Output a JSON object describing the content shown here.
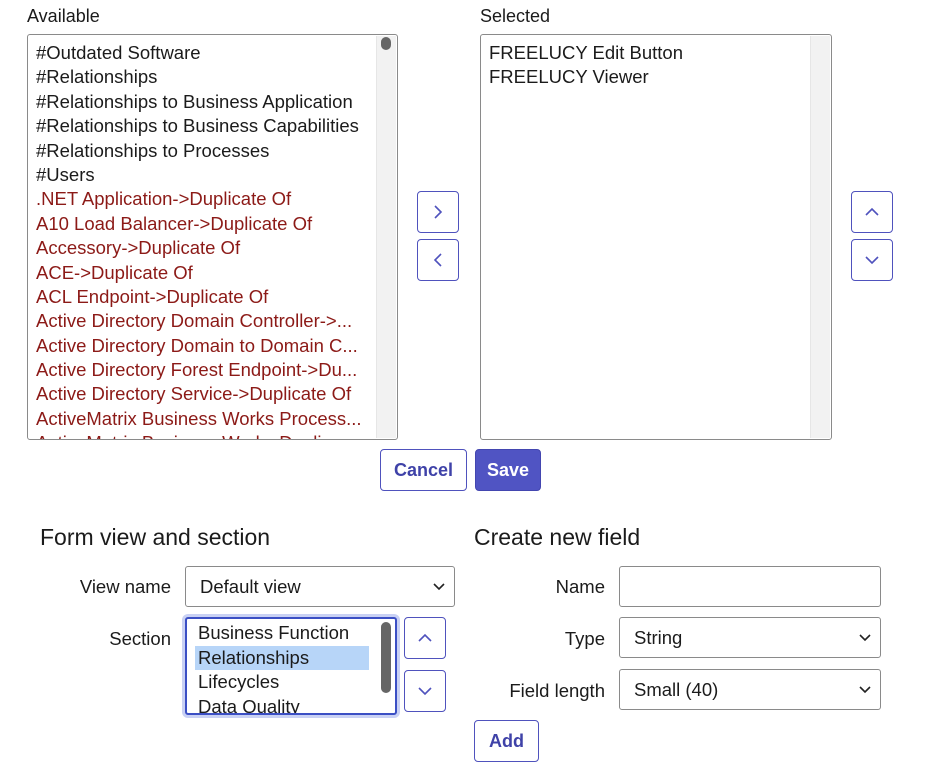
{
  "available": {
    "label": "Available",
    "items": [
      {
        "text": "#Outdated Software",
        "kind": "plain"
      },
      {
        "text": "#Relationships",
        "kind": "plain"
      },
      {
        "text": "#Relationships to Business Application",
        "kind": "plain"
      },
      {
        "text": "#Relationships to Business Capabilities",
        "kind": "plain"
      },
      {
        "text": "#Relationships to Processes",
        "kind": "plain"
      },
      {
        "text": "#Users",
        "kind": "plain"
      },
      {
        "text": ".NET Application->Duplicate Of",
        "kind": "dup"
      },
      {
        "text": "A10 Load Balancer->Duplicate Of",
        "kind": "dup"
      },
      {
        "text": "Accessory->Duplicate Of",
        "kind": "dup"
      },
      {
        "text": "ACE->Duplicate Of",
        "kind": "dup"
      },
      {
        "text": "ACL Endpoint->Duplicate Of",
        "kind": "dup"
      },
      {
        "text": "Active Directory Domain Controller->...",
        "kind": "dup"
      },
      {
        "text": "Active Directory Domain to Domain C...",
        "kind": "dup"
      },
      {
        "text": "Active Directory Forest Endpoint->Du...",
        "kind": "dup"
      },
      {
        "text": "Active Directory Service->Duplicate Of",
        "kind": "dup"
      },
      {
        "text": "ActiveMatrix Business Works Process...",
        "kind": "dup"
      },
      {
        "text": "ActiveMatrix Business Works Duplic...",
        "kind": "dup"
      }
    ]
  },
  "selected": {
    "label": "Selected",
    "items": [
      "FREELUCY Edit Button",
      "FREELUCY Viewer"
    ]
  },
  "buttons": {
    "cancel": "Cancel",
    "save": "Save",
    "add": "Add"
  },
  "icons": {
    "move_right": "chevron-right-icon",
    "move_left": "chevron-left-icon",
    "move_up": "chevron-up-icon",
    "move_down": "chevron-down-icon"
  },
  "form_view": {
    "title": "Form view and section",
    "view_name_label": "View name",
    "view_name_value": "Default view",
    "section_label": "Section",
    "sections": [
      {
        "text": "Business Function",
        "selected": false
      },
      {
        "text": "Relationships",
        "selected": true
      },
      {
        "text": "Lifecycles",
        "selected": false
      },
      {
        "text": "Data Quality",
        "selected": false
      }
    ]
  },
  "new_field": {
    "title": "Create new field",
    "name_label": "Name",
    "name_value": "",
    "type_label": "Type",
    "type_value": "String",
    "length_label": "Field length",
    "length_value": "Small (40)"
  },
  "colors": {
    "accent": "#5054c3",
    "duplicate_text": "#8c1a17",
    "selection": "#b7d5f8"
  }
}
